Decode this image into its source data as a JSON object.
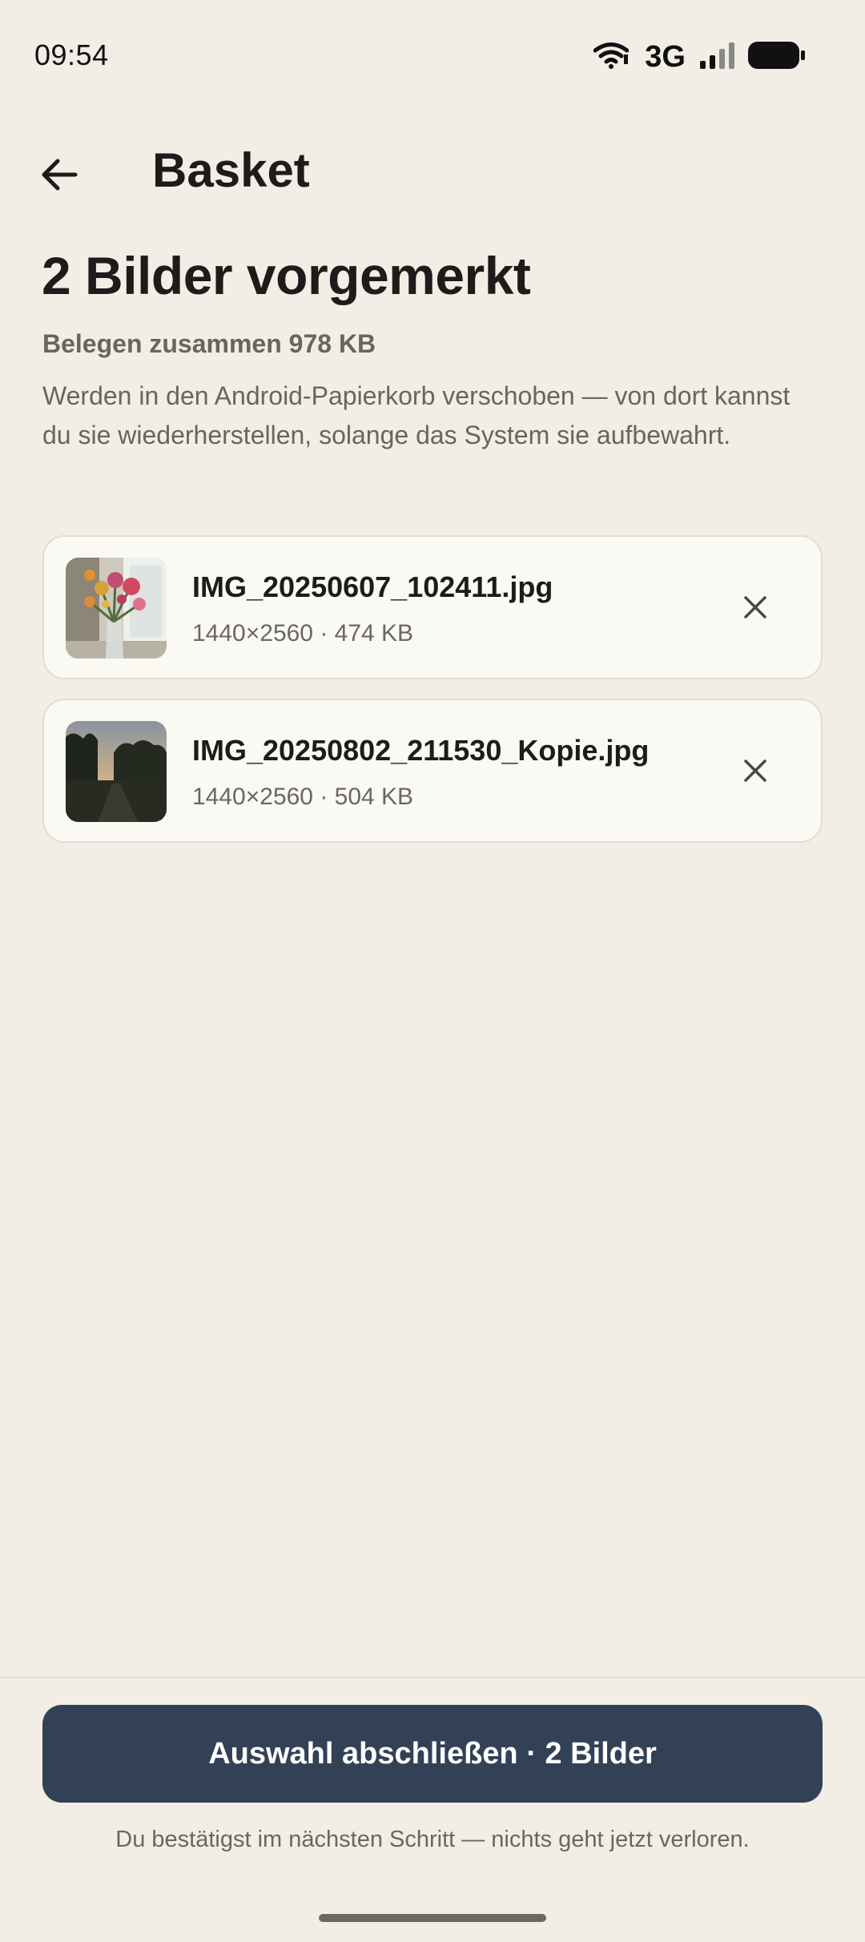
{
  "status_bar": {
    "time": "09:54",
    "network": "3G",
    "icons": [
      "wifi-icon",
      "signal-icon",
      "battery-icon"
    ]
  },
  "app_bar": {
    "title": "Basket",
    "back_icon": "arrow-left-icon"
  },
  "main": {
    "heading": "2 Bilder vorgemerkt",
    "summary": "Belegen zusammen 978 KB",
    "description": "Werden in den Android-Papierkorb verschoben — von dort kannst du sie wiederherstellen, solange das System sie aufbewahrt.",
    "files": [
      {
        "name": "IMG_20250607_102411.jpg",
        "meta": "1440×2560 · 474 KB",
        "thumbnail": "flowers-photo"
      },
      {
        "name": "IMG_20250802_211530_Kopie.jpg",
        "meta": "1440×2560 · 504 KB",
        "thumbnail": "sunset-trees-photo"
      }
    ]
  },
  "footer": {
    "button_label": "Auswahl abschließen · 2 Bilder",
    "hint": "Du bestätigst im nächsten Schritt — nichts geht jetzt verloren."
  },
  "colors": {
    "background": "#f2eee5",
    "card": "#fbf9f3",
    "primary_button": "#334157",
    "muted_text": "#68655f"
  }
}
